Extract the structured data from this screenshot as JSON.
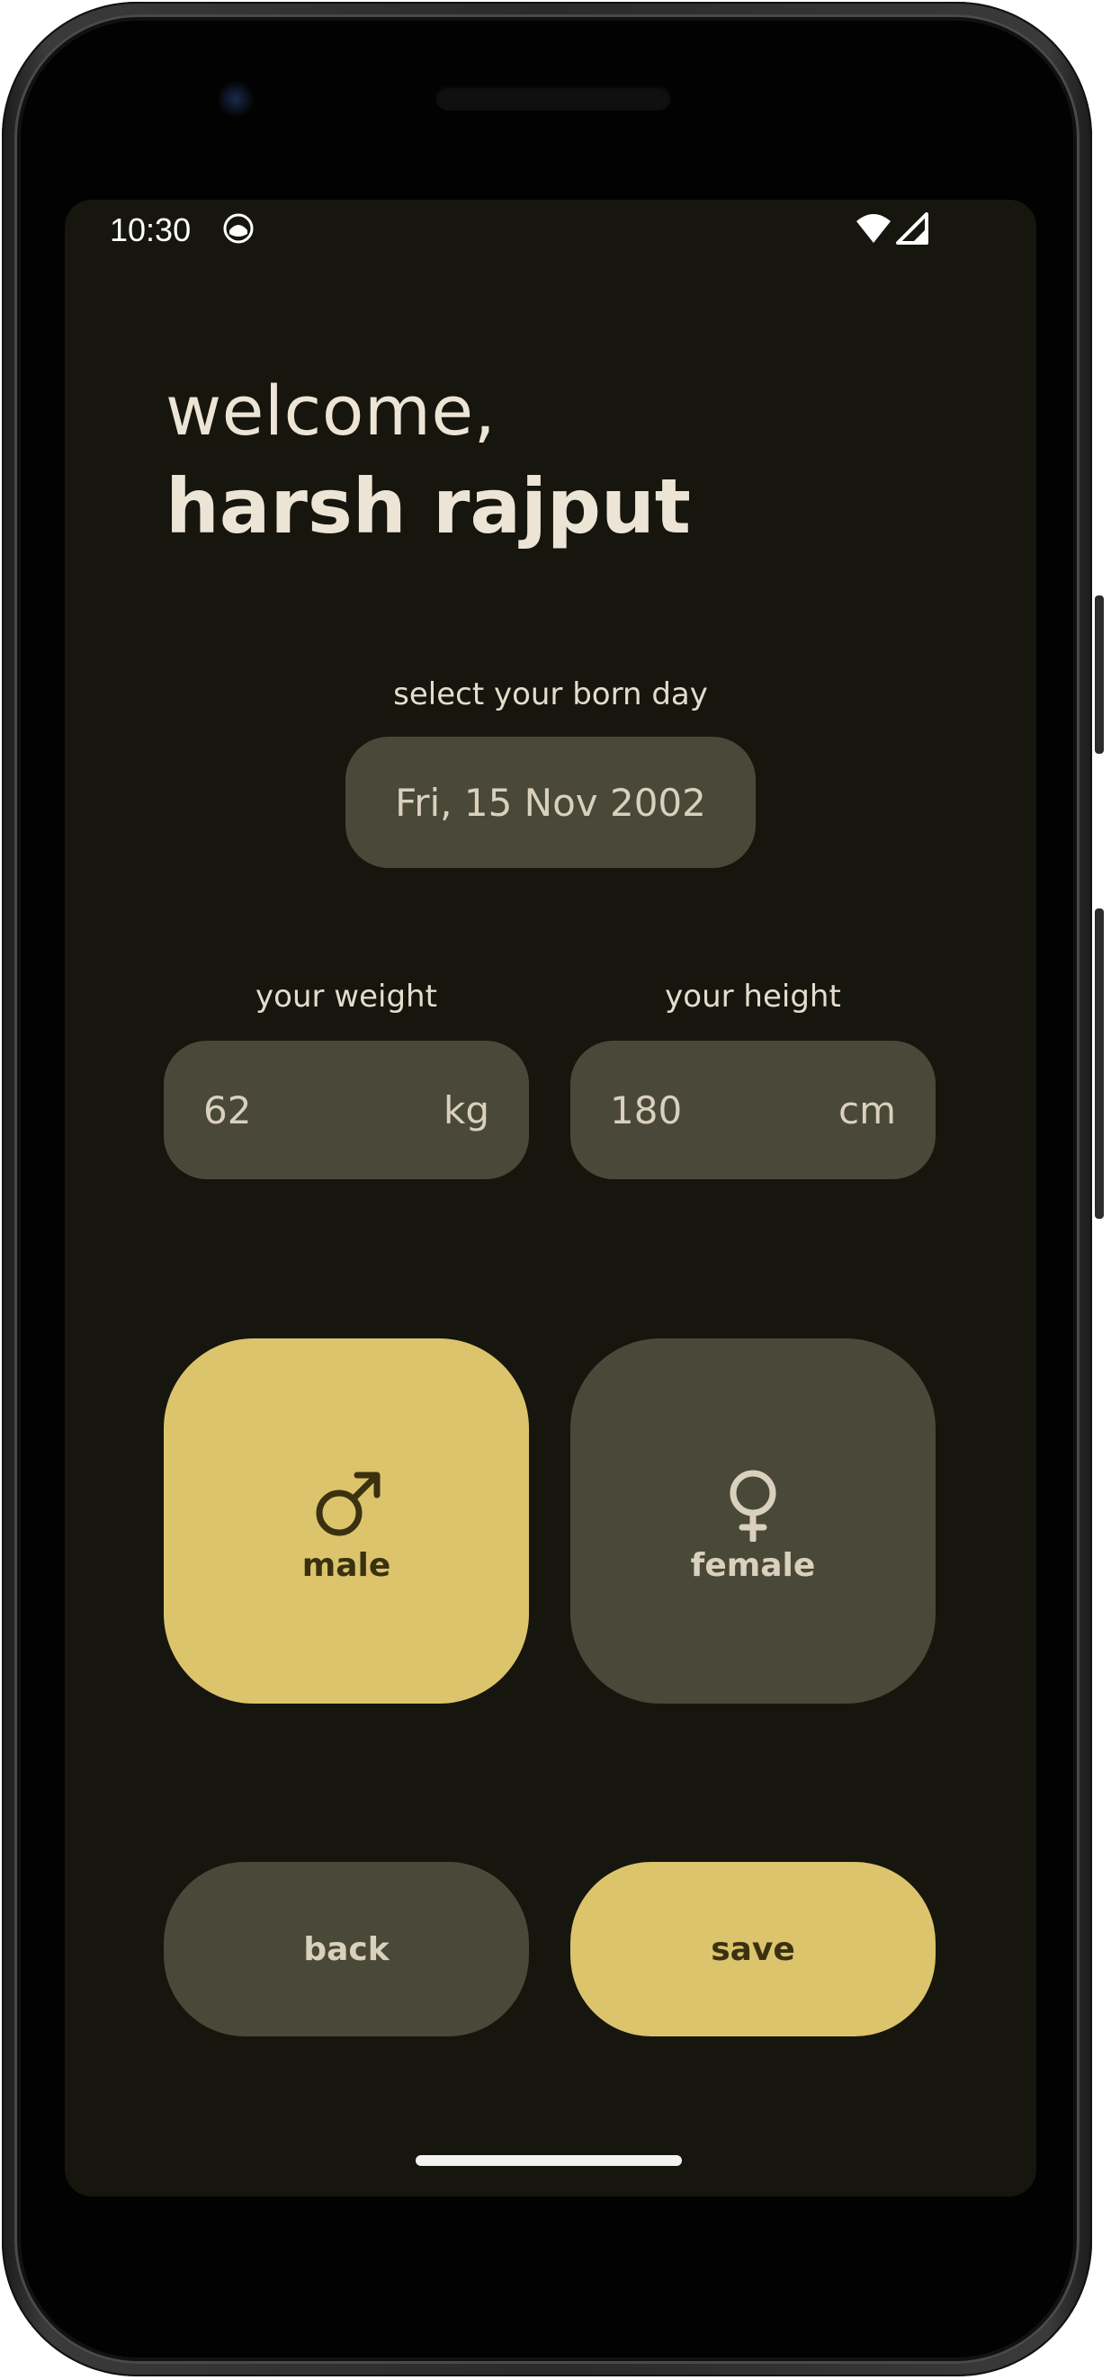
{
  "status_bar": {
    "time": "10:30",
    "app_icon": "cat-face-icon",
    "wifi_icon": "wifi-icon",
    "signal_icon": "signal-icon"
  },
  "header": {
    "greeting": "welcome,",
    "user_name": "harsh rajput"
  },
  "birthday": {
    "label": "select your born day",
    "value": "Fri, 15 Nov 2002"
  },
  "weight": {
    "label": "your weight",
    "value": "62",
    "unit": "kg"
  },
  "height": {
    "label": "your height",
    "value": "180",
    "unit": "cm"
  },
  "gender": {
    "selected": "male",
    "male_label": "male",
    "male_icon": "male-symbol-icon",
    "female_label": "female",
    "female_icon": "female-symbol-icon"
  },
  "actions": {
    "back_label": "back",
    "save_label": "save"
  },
  "colors": {
    "background": "#16150e",
    "surface": "#4a4838",
    "accent": "#dcc46c",
    "text": "#ece5d6"
  }
}
